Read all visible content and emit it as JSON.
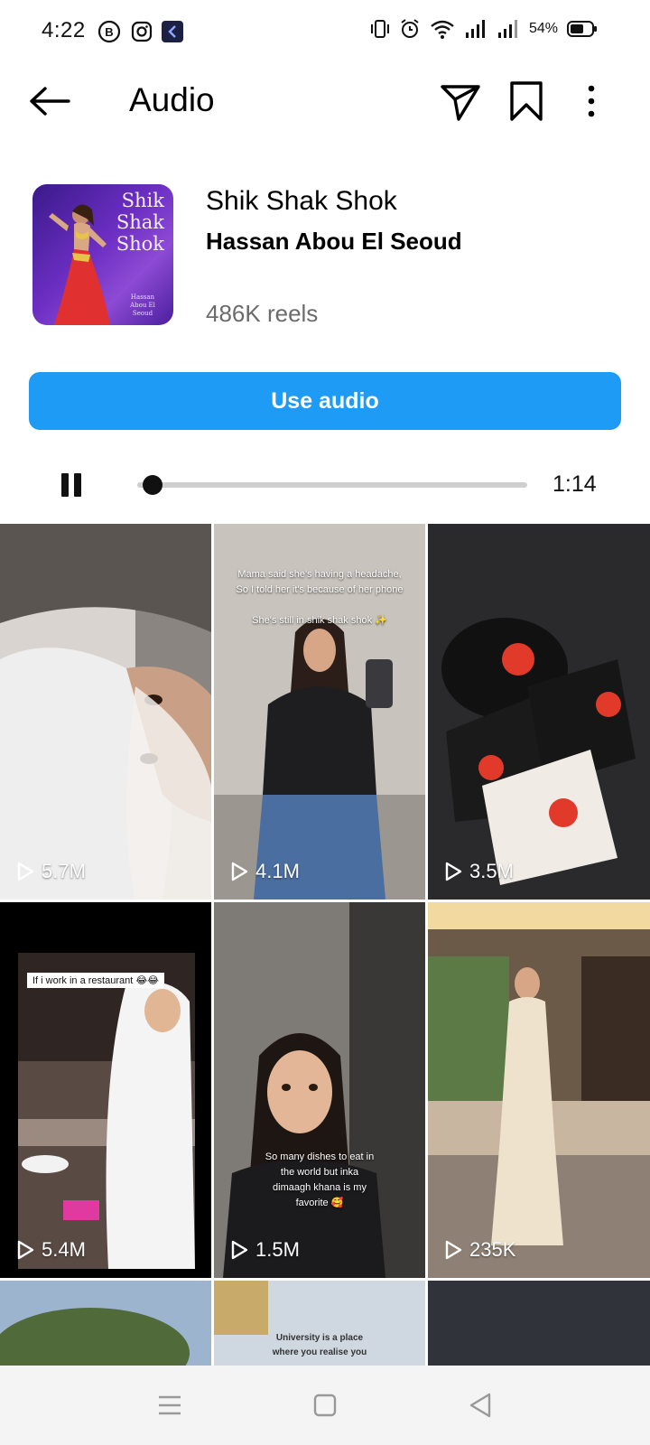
{
  "status_bar": {
    "time": "4:22",
    "battery": "54%"
  },
  "header": {
    "title": "Audio"
  },
  "audio": {
    "title": "Shik Shak Shok",
    "artist": "Hassan Abou El Seoud",
    "reels_count": "486K reels",
    "cover_title_lines": [
      "Shik",
      "Shak",
      "Shok"
    ],
    "cover_credit": "Hassan Abou El Seoud",
    "use_button": "Use audio"
  },
  "player": {
    "duration": "1:14",
    "progress": 0.03,
    "state": "playing"
  },
  "reels": [
    {
      "views": "5.7M",
      "caption": []
    },
    {
      "views": "4.1M",
      "caption": [
        "Mama said she's having a headache,",
        "So I told her it's because of her phone",
        "",
        "She's still in shik shak shok ✨"
      ]
    },
    {
      "views": "3.5M",
      "caption": []
    },
    {
      "views": "5.4M",
      "caption": [
        "If i work in a restaurant 😂😂"
      ]
    },
    {
      "views": "1.5M",
      "caption": [
        "So many dishes to eat in",
        "the world but inka",
        "dimaagh khana is my",
        "favorite 🥰"
      ]
    },
    {
      "views": "235K",
      "caption": []
    },
    {
      "views": "",
      "caption": []
    },
    {
      "views": "",
      "caption": [
        "University is a place",
        "where you realise you"
      ]
    },
    {
      "views": "",
      "caption": []
    }
  ],
  "colors": {
    "accent": "#1d9bf5",
    "secondary_text": "#6b6b6b"
  }
}
